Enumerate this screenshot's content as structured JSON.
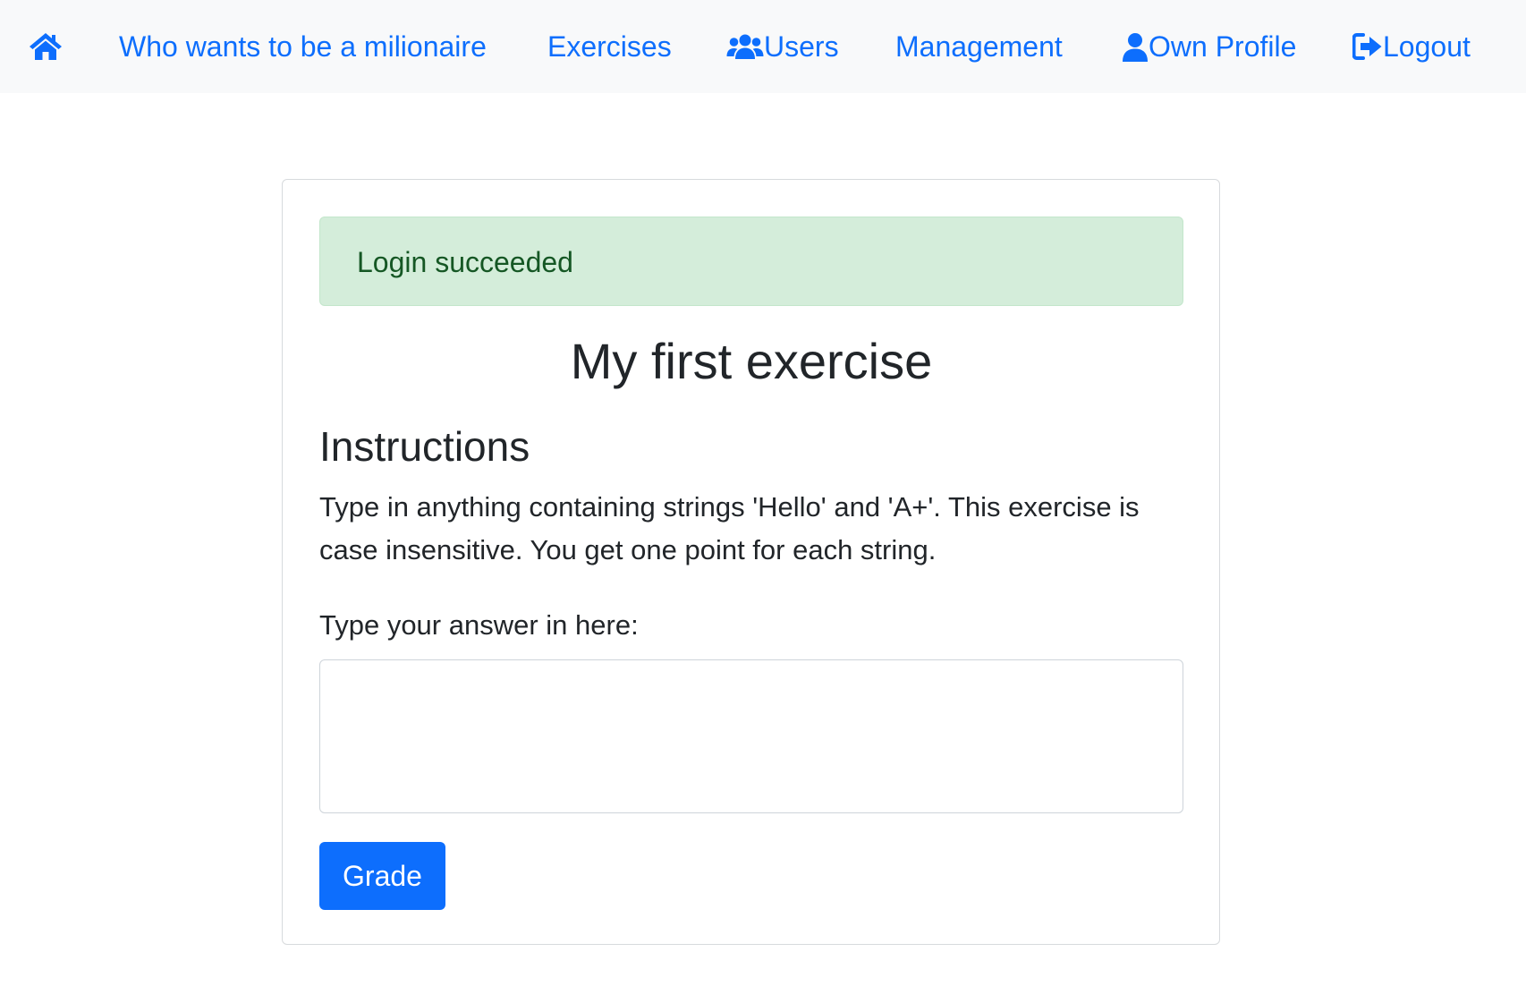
{
  "navbar": {
    "home_icon": "home-icon",
    "items": [
      {
        "label": "Who wants to be a milionaire",
        "icon": null
      },
      {
        "label": "Exercises",
        "icon": null
      },
      {
        "label": "Users",
        "icon": "users-icon"
      },
      {
        "label": "Management",
        "icon": null
      },
      {
        "label": "Own Profile",
        "icon": "user-icon"
      },
      {
        "label": "Logout",
        "icon": "sign-out-icon"
      }
    ]
  },
  "alert": {
    "message": "Login succeeded"
  },
  "exercise": {
    "title": "My first exercise",
    "instructions_heading": "Instructions",
    "instructions_text": "Type in anything containing strings 'Hello' and 'A+'. This exercise is case insensitive. You get one point for each string.",
    "answer_label": "Type your answer in here:",
    "answer_value": "",
    "grade_label": "Grade"
  },
  "colors": {
    "link": "#0d6efd",
    "navbar_bg": "#f8f9fa",
    "alert_bg": "#d4edda",
    "alert_text": "#155724",
    "button_bg": "#0d6efd"
  }
}
